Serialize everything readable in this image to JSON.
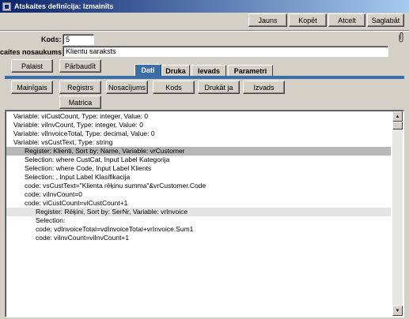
{
  "window": {
    "title": "Atskaites definīcija: Izmainīts"
  },
  "toolbar": {
    "new_label": "Jauns",
    "copy_label": "Kopēt",
    "cancel_label": "Atcelt",
    "save_label": "Saglabāt"
  },
  "form": {
    "code_label": "Kods:",
    "code_value": "5",
    "name_label": "caites nosaukums:",
    "name_value": "Klientu saraksts"
  },
  "actions": {
    "run_label": "Palaist",
    "check_label": "Pārbaudīt"
  },
  "tabs": [
    {
      "label": "Dati",
      "active": true
    },
    {
      "label": "Druka"
    },
    {
      "label": "Ievads"
    },
    {
      "label": "Parametri"
    }
  ],
  "inner_buttons": {
    "variables": "Mainīgais",
    "register": "Reģistrs",
    "setting": "Nosacījums",
    "code": "Kods",
    "print": "Drukāt ja",
    "input": "Izvads",
    "matrix": "Matrica"
  },
  "code_lines": [
    {
      "text": "Variable: viCustCount, Type: integer, Value: 0",
      "indent": 0
    },
    {
      "text": "Variable: viInvCount, Type: integer, Value: 0",
      "indent": 0
    },
    {
      "text": "Variable: vlInvoiceTotal, Type: decimal, Value: 0",
      "indent": 0
    },
    {
      "text": "Variable: vsCustText, Type: string",
      "indent": 0
    },
    {
      "text": "Register: Klienti, Sort by: Name, Variable: vrCustomer",
      "indent": 1,
      "state": "selected"
    },
    {
      "text": "Selection: where CustCat, Input Label Kategorija",
      "indent": 1
    },
    {
      "text": "Selection: where Code, Input Label Klients",
      "indent": 1
    },
    {
      "text": "Selection: , Input Label Klasifikacija",
      "indent": 1
    },
    {
      "text": "code: vsCustText=\"Klienta rēķinu summa\"&vrCustomer.Code",
      "indent": 1
    },
    {
      "text": "code: viInvCount=0",
      "indent": 1
    },
    {
      "text": "code: viCustCount=viCustCount+1",
      "indent": 1
    },
    {
      "text": "Register: Rēķini, Sort by: SerNr, Variable: vrInvoice",
      "indent": 2,
      "state": "highlight"
    },
    {
      "text": "Selection:",
      "indent": 2
    },
    {
      "text": "code: vdInvoiceTotal=vdInvoiceTotal+vrInvoice.Sum1",
      "indent": 2
    },
    {
      "text": "code: viInvCount=viInvCount+1",
      "indent": 2
    }
  ]
}
